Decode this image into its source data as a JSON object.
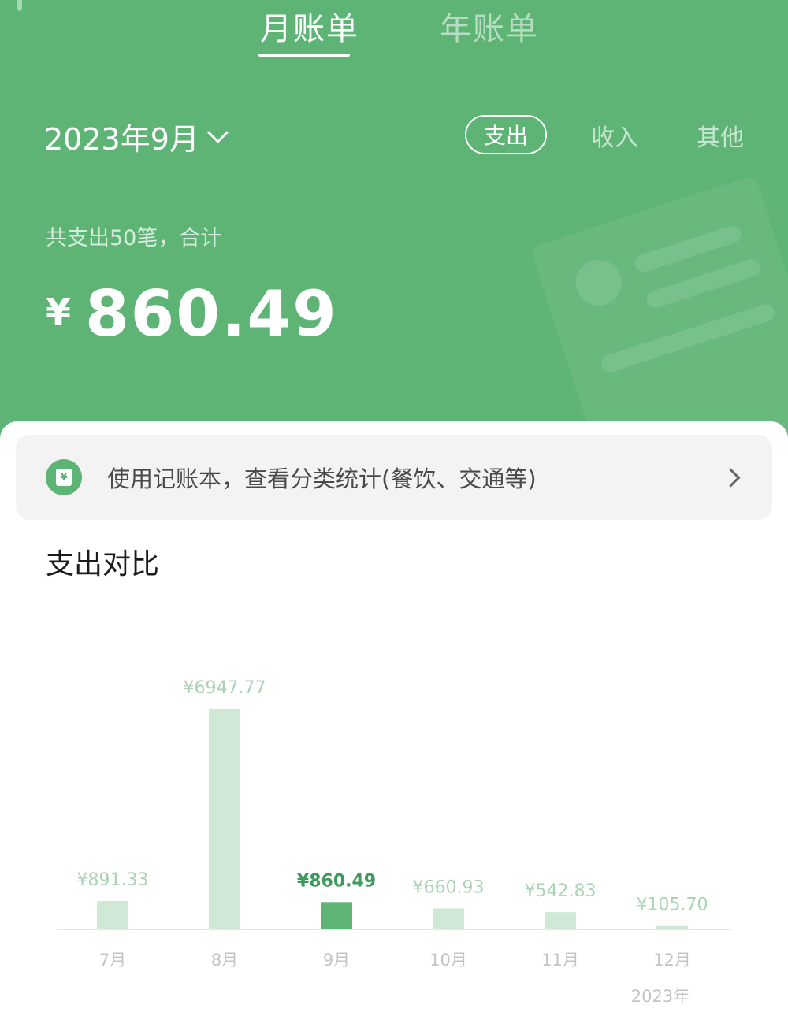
{
  "tabs": [
    {
      "label": "月账单",
      "active": true
    },
    {
      "label": "年账单",
      "active": false
    }
  ],
  "period": {
    "label": "2023年9月"
  },
  "filters": {
    "expense": "支出",
    "income": "收入",
    "other": "其他",
    "selected": "支出"
  },
  "summary": {
    "text": "共支出50笔，合计",
    "currency": "¥",
    "amount": "860.49"
  },
  "promo": {
    "text": "使用记账本，查看分类统计(餐饮、交通等)"
  },
  "comparison": {
    "title": "支出对比"
  },
  "colors": {
    "brand": "#5db475",
    "bar_inactive": "#cfe9d6",
    "bar_active": "#5db475",
    "label_inactive": "#a9d3b4",
    "label_active": "#3e9a5a"
  },
  "chart_data": {
    "type": "bar",
    "categories": [
      "7月",
      "8月",
      "9月",
      "10月",
      "11月",
      "12月"
    ],
    "values": [
      891.33,
      6947.77,
      860.49,
      660.93,
      542.83,
      105.7
    ],
    "value_labels": [
      "¥891.33",
      "¥6947.77",
      "¥860.49",
      "¥660.93",
      "¥542.83",
      "¥105.70"
    ],
    "highlight": "9月",
    "year_label": "2023年",
    "grid": false
  }
}
